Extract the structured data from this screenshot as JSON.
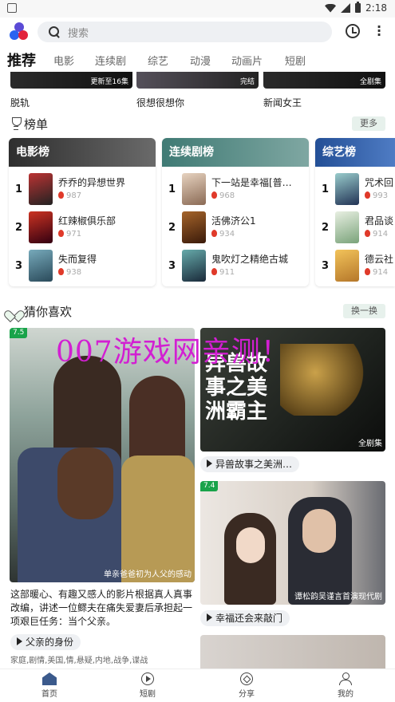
{
  "status_bar": {
    "time": "2:18"
  },
  "search": {
    "placeholder": "搜索"
  },
  "tabs": [
    "推荐",
    "电影",
    "连续剧",
    "综艺",
    "动漫",
    "动画片",
    "短剧"
  ],
  "top_row": [
    {
      "title": "脱轨",
      "overlay": "更新至16集"
    },
    {
      "title": "很想很想你",
      "overlay": "完结"
    },
    {
      "title": "新闻女王",
      "overlay": "全剧集"
    }
  ],
  "ranking": {
    "title": "榜单",
    "more": "更多",
    "columns": [
      {
        "title": "电影榜",
        "color": "#3a3a3a",
        "items": [
          {
            "no": "1",
            "name": "乔乔的异想世界",
            "heat": "987"
          },
          {
            "no": "2",
            "name": "红辣椒俱乐部",
            "heat": "971"
          },
          {
            "no": "3",
            "name": "失而复得",
            "heat": "938"
          }
        ]
      },
      {
        "title": "连续剧榜",
        "color": "#4a7d78",
        "items": [
          {
            "no": "1",
            "name": "下一站是幸福[普…",
            "heat": "968"
          },
          {
            "no": "2",
            "name": "活佛济公1",
            "heat": "934"
          },
          {
            "no": "3",
            "name": "鬼吹灯之精绝古城",
            "heat": "911"
          }
        ]
      },
      {
        "title": "综艺榜",
        "color": "#2c5aa0",
        "items": [
          {
            "no": "1",
            "name": "咒术回",
            "heat": "993"
          },
          {
            "no": "2",
            "name": "君品谈",
            "heat": "914"
          },
          {
            "no": "3",
            "name": "德云社",
            "heat": "914"
          }
        ]
      }
    ]
  },
  "guess": {
    "title": "猜你喜欢",
    "refresh": "换一换",
    "left": {
      "score": "7.5",
      "overlay": "单亲爸爸初为人父的感动",
      "desc": "这部暖心、有趣又感人的影片根据真人真事改编，讲述一位鳏夫在痛失爱妻后承担起一项艰巨任务：当个父亲。",
      "title": "父亲的身份",
      "tags": "家庭,剧情,美国,情,悬疑,内地,战争,谍战"
    },
    "right1": {
      "overlay": "全剧集",
      "art_text": "异兽故事之美洲霸主",
      "title": "异兽故事之美洲…"
    },
    "right2": {
      "score": "7.4",
      "overlay": "谭松韵吴谨言首演现代剧",
      "title": "幸福还会来敲门"
    }
  },
  "watermark": "007游戏网亲测！",
  "bottom_nav": [
    "首页",
    "短剧",
    "分享",
    "我的"
  ]
}
